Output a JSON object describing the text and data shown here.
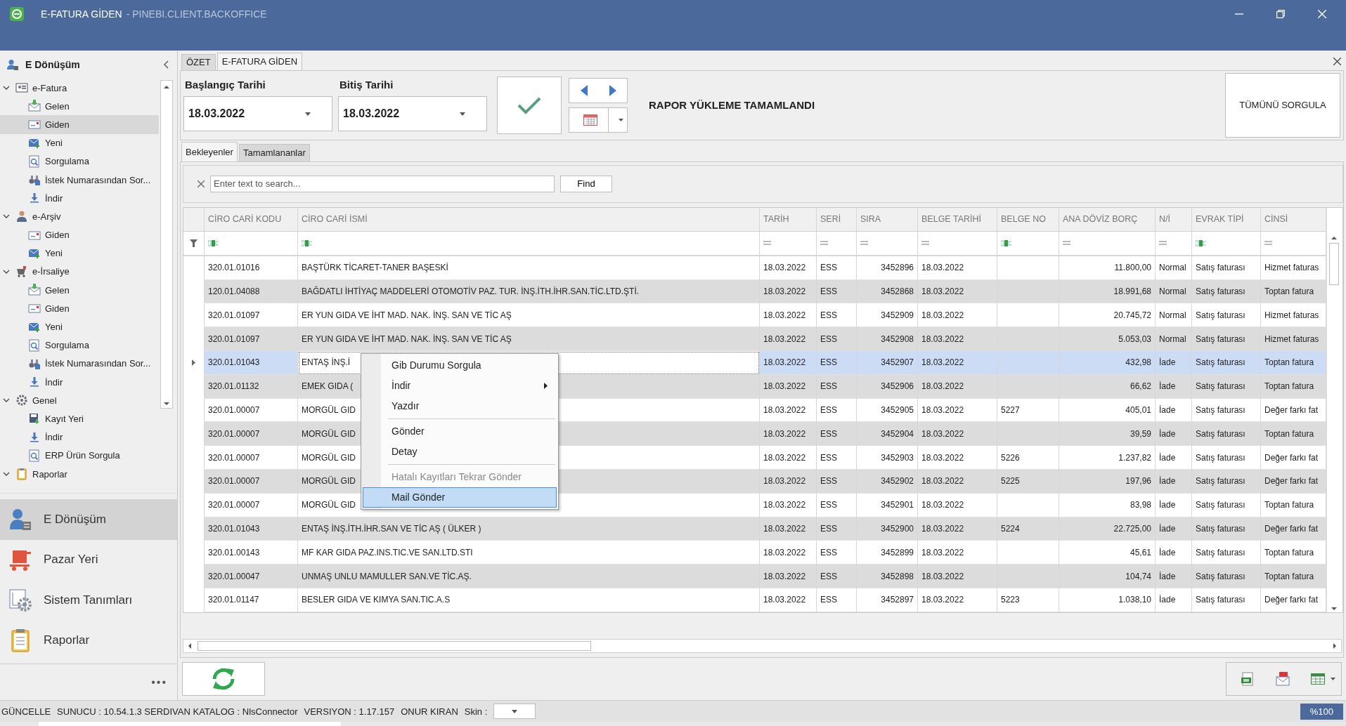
{
  "window": {
    "title": "E-FATURA GİDEN",
    "subtitle": "- PINEBI.CLIENT.BACKOFFICE"
  },
  "sidebar": {
    "title": "E Dönüşüm",
    "tree": [
      {
        "label": "e-Fatura",
        "kind": "card",
        "expanded": true,
        "children": [
          {
            "label": "Gelen",
            "kind": "inbox",
            "selected": false
          },
          {
            "label": "Giden",
            "kind": "outbox",
            "selected": true
          },
          {
            "label": "Yeni",
            "kind": "new",
            "selected": false
          },
          {
            "label": "Sorgulama",
            "kind": "query",
            "selected": false
          },
          {
            "label": "İstek Numarasından Sor...",
            "kind": "binoculars",
            "selected": false
          },
          {
            "label": "İndir",
            "kind": "download",
            "selected": false
          }
        ]
      },
      {
        "label": "e-Arşiv",
        "kind": "person",
        "expanded": true,
        "children": [
          {
            "label": "Giden",
            "kind": "outbox",
            "selected": false
          },
          {
            "label": "Yeni",
            "kind": "new",
            "selected": false
          }
        ]
      },
      {
        "label": "e-İrsaliye",
        "kind": "cart",
        "expanded": true,
        "children": [
          {
            "label": "Gelen",
            "kind": "inbox",
            "selected": false
          },
          {
            "label": "Giden",
            "kind": "outbox",
            "selected": false
          },
          {
            "label": "Yeni",
            "kind": "new",
            "selected": false
          },
          {
            "label": "Sorgulama",
            "kind": "query",
            "selected": false
          },
          {
            "label": "İstek Numarasından Sor...",
            "kind": "binoculars",
            "selected": false
          },
          {
            "label": "İndir",
            "kind": "download",
            "selected": false
          }
        ]
      },
      {
        "label": "Genel",
        "kind": "gear",
        "expanded": true,
        "children": [
          {
            "label": "Kayıt Yeri",
            "kind": "disk",
            "selected": false
          },
          {
            "label": "İndir",
            "kind": "download",
            "selected": false
          },
          {
            "label": "ERP Ürün Sorgula",
            "kind": "query",
            "selected": false
          }
        ]
      },
      {
        "label": "Raporlar",
        "kind": "clipboard",
        "expanded": true
      }
    ],
    "modules": [
      {
        "label": "E Dönüşüm",
        "kind": "person",
        "selected": true
      },
      {
        "label": "Pazar Yeri",
        "kind": "cart",
        "selected": false
      },
      {
        "label": "Sistem Tanımları",
        "kind": "gear",
        "selected": false
      },
      {
        "label": "Raporlar",
        "kind": "clipboard",
        "selected": false
      }
    ],
    "more": "•••"
  },
  "tabs": [
    {
      "label": "ÖZET",
      "selected": false
    },
    {
      "label": "E-FATURA GİDEN",
      "selected": true
    }
  ],
  "filters": {
    "start_label": "Başlangıç Tarihi",
    "start_date": "18.03.2022",
    "end_label": "Bitiş Tarihi",
    "end_date": "18.03.2022",
    "status": "RAPOR YÜKLEME TAMAMLANDI",
    "query_all": "TÜMÜNÜ SORGULA"
  },
  "subtabs": [
    {
      "label": "Bekleyenler",
      "selected": true
    },
    {
      "label": "Tamamlananlar",
      "selected": false
    }
  ],
  "search": {
    "placeholder": "Enter text to search...",
    "button": "Find"
  },
  "table": {
    "columns": [
      {
        "label": "CİRO CARİ KODU",
        "kind": "text"
      },
      {
        "label": "CİRO CARİ İSMİ",
        "kind": "text"
      },
      {
        "label": "TARİH",
        "kind": "date"
      },
      {
        "label": "SERİ",
        "kind": "choice"
      },
      {
        "label": "SIRA",
        "kind": "number"
      },
      {
        "label": "BELGE TARİHİ",
        "kind": "date"
      },
      {
        "label": "BELGE NO",
        "kind": "text"
      },
      {
        "label": "ANA DÖVİZ BORÇ",
        "kind": "number"
      },
      {
        "label": "N/İ",
        "kind": "choice"
      },
      {
        "label": "EVRAK TİPİ",
        "kind": "text"
      },
      {
        "label": "CİNSİ",
        "kind": "choice"
      }
    ],
    "rows": [
      {
        "selected": false,
        "cells": [
          "320.01.01016",
          "BAŞTÜRK TİCARET-TANER BAŞESKİ",
          "18.03.2022",
          "ESS",
          "3452896",
          "18.03.2022",
          "",
          "11.800,00",
          "Normal",
          "Satış faturası",
          "Hizmet faturas"
        ]
      },
      {
        "selected": false,
        "cells": [
          "120.01.04088",
          "BAĞDATLI İHTİYAÇ MADDELERİ OTOMOTİV PAZ. TUR. İNŞ.İTH.İHR.SAN.TİC.LTD.ŞTİ.",
          "18.03.2022",
          "ESS",
          "3452868",
          "18.03.2022",
          "",
          "18.991,68",
          "Normal",
          "Satış faturası",
          "Toptan fatura"
        ]
      },
      {
        "selected": false,
        "cells": [
          "320.01.01097",
          "ER YUN GIDA VE İHT MAD. NAK. İNŞ. SAN VE TİC AŞ",
          "18.03.2022",
          "ESS",
          "3452909",
          "18.03.2022",
          "",
          "20.745,72",
          "Normal",
          "Satış faturası",
          "Hizmet faturas"
        ]
      },
      {
        "selected": false,
        "cells": [
          "320.01.01097",
          "ER YUN GIDA VE İHT MAD. NAK. İNŞ. SAN VE TİC AŞ",
          "18.03.2022",
          "ESS",
          "3452908",
          "18.03.2022",
          "",
          "5.053,03",
          "Normal",
          "Satış faturası",
          "Hizmet faturas"
        ]
      },
      {
        "selected": true,
        "cells": [
          "320.01.01043",
          "ENTAŞ İNŞ.İ",
          "18.03.2022",
          "ESS",
          "3452907",
          "18.03.2022",
          "",
          "432,98",
          "İade",
          "Satış faturası",
          "Toptan fatura"
        ]
      },
      {
        "selected": false,
        "cells": [
          "320.01.01132",
          "EMEK GIDA (",
          "18.03.2022",
          "ESS",
          "3452906",
          "18.03.2022",
          "",
          "66,62",
          "İade",
          "Satış faturası",
          "Toptan fatura"
        ]
      },
      {
        "selected": false,
        "cells": [
          "320.01.00007",
          "MORGÜL GID",
          "18.03.2022",
          "ESS",
          "3452905",
          "18.03.2022",
          "5227",
          "405,01",
          "İade",
          "Satış faturası",
          "Değer farkı fat"
        ]
      },
      {
        "selected": false,
        "cells": [
          "320.01.00007",
          "MORGÜL GID",
          "18.03.2022",
          "ESS",
          "3452904",
          "18.03.2022",
          "",
          "39,59",
          "İade",
          "Satış faturası",
          "Toptan fatura"
        ]
      },
      {
        "selected": false,
        "cells": [
          "320.01.00007",
          "MORGÜL GID",
          "18.03.2022",
          "ESS",
          "3452903",
          "18.03.2022",
          "5226",
          "1.237,82",
          "İade",
          "Satış faturası",
          "Değer farkı fat"
        ]
      },
      {
        "selected": false,
        "cells": [
          "320.01.00007",
          "MORGÜL GID",
          "18.03.2022",
          "ESS",
          "3452902",
          "18.03.2022",
          "5225",
          "197,96",
          "İade",
          "Satış faturası",
          "Değer farkı fat"
        ]
      },
      {
        "selected": false,
        "cells": [
          "320.01.00007",
          "MORGÜL GID",
          "18.03.2022",
          "ESS",
          "3452901",
          "18.03.2022",
          "",
          "83,98",
          "İade",
          "Satış faturası",
          "Toptan fatura"
        ]
      },
      {
        "selected": false,
        "cells": [
          "320.01.01043",
          "ENTAŞ İNŞ.İTH.İHR.SAN VE TİC AŞ ( ÜLKER )",
          "18.03.2022",
          "ESS",
          "3452900",
          "18.03.2022",
          "5224",
          "22.725,00",
          "İade",
          "Satış faturası",
          "Değer farkı fat"
        ]
      },
      {
        "selected": false,
        "cells": [
          "320.01.00143",
          "MF KAR GIDA PAZ.INS.TIC.VE SAN.LTD.STI",
          "18.03.2022",
          "ESS",
          "3452899",
          "18.03.2022",
          "",
          "45,61",
          "İade",
          "Satış faturası",
          "Toptan fatura"
        ]
      },
      {
        "selected": false,
        "cells": [
          "320.01.00047",
          "UNMAŞ UNLU MAMULLER SAN.VE TİC.AŞ.",
          "18.03.2022",
          "ESS",
          "3452898",
          "18.03.2022",
          "",
          "104,74",
          "İade",
          "Satış faturası",
          "Toptan fatura"
        ]
      },
      {
        "selected": false,
        "cells": [
          "320.01.01147",
          "BESLER GIDA VE KIMYA SAN.TIC.A.S",
          "18.03.2022",
          "ESS",
          "3452897",
          "18.03.2022",
          "5223",
          "1.038,10",
          "İade",
          "Satış faturası",
          "Değer farkı fat"
        ]
      }
    ]
  },
  "context_menu": [
    {
      "kind": "item",
      "label": "Gib Durumu Sorgula",
      "submenu": false,
      "disabled": false,
      "selected": false
    },
    {
      "kind": "item",
      "label": "İndir",
      "submenu": true,
      "disabled": false,
      "selected": false
    },
    {
      "kind": "item",
      "label": "Yazdır",
      "submenu": false,
      "disabled": false,
      "selected": false
    },
    {
      "kind": "separator"
    },
    {
      "kind": "item",
      "label": "Gönder",
      "submenu": false,
      "disabled": false,
      "selected": false
    },
    {
      "kind": "item",
      "label": "Detay",
      "submenu": false,
      "disabled": false,
      "selected": false
    },
    {
      "kind": "separator"
    },
    {
      "kind": "item",
      "label": "Hatalı Kayıtları Tekrar Gönder",
      "submenu": false,
      "disabled": true,
      "selected": false
    },
    {
      "kind": "item",
      "label": "Mail Gönder",
      "submenu": false,
      "disabled": false,
      "selected": true
    }
  ],
  "status_bar": {
    "items": [
      "GÜNCELLE",
      "SUNUCU : 10.54.1.3 SERDIVAN KATALOG : NlsConnector",
      "VERSIYON : 1.17.157",
      "ONUR KIRAN"
    ],
    "skin_label": "Skin :",
    "zoom": "%100"
  }
}
